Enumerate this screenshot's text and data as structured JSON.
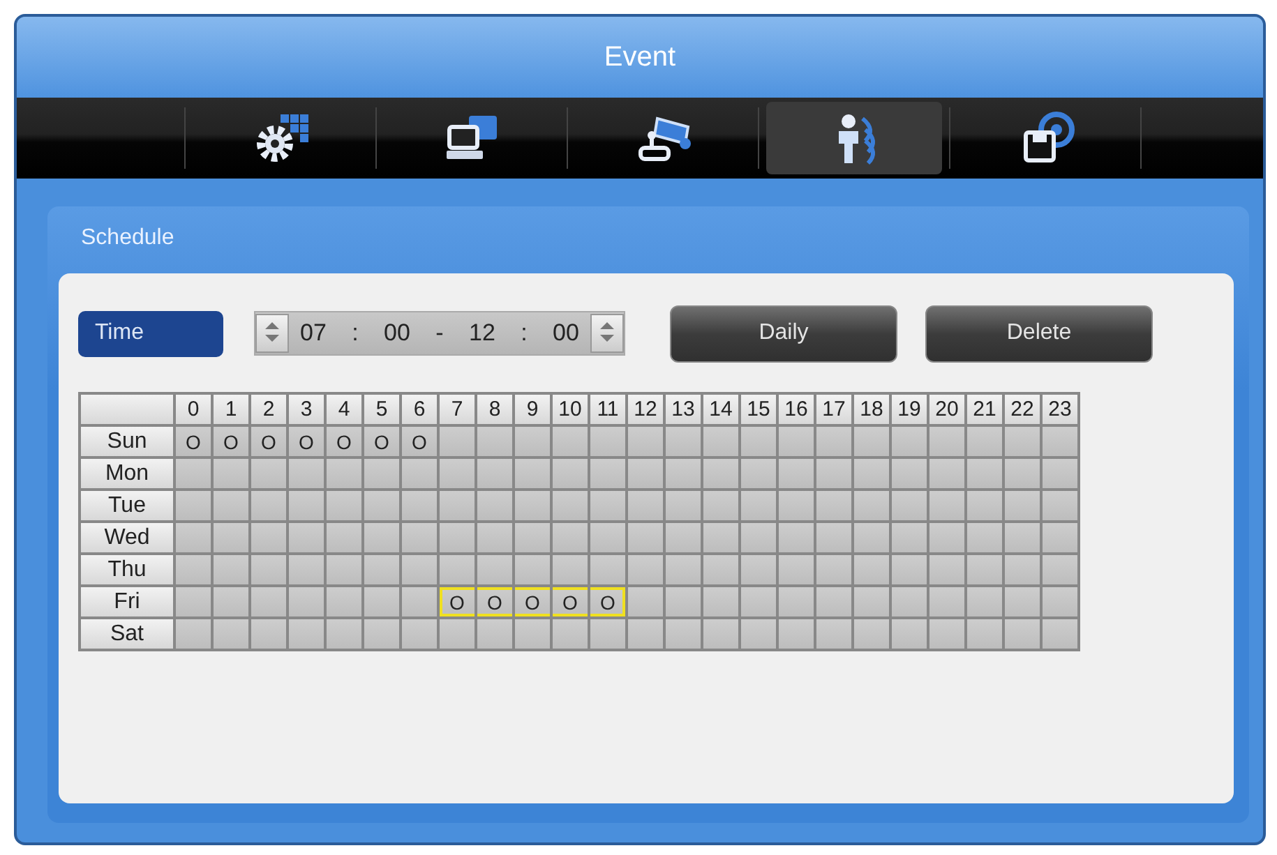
{
  "window": {
    "title": "Event"
  },
  "toolbar": [
    {
      "kind": "setup",
      "selected": false
    },
    {
      "kind": "network",
      "selected": false
    },
    {
      "kind": "camera",
      "selected": false
    },
    {
      "kind": "event",
      "selected": true
    },
    {
      "kind": "storage",
      "selected": false
    }
  ],
  "panel": {
    "title": "Schedule"
  },
  "time": {
    "label": "Time",
    "start": {
      "hour": "07",
      "colon": ":",
      "minute": "00"
    },
    "dash": "-",
    "end": {
      "hour": "12",
      "colon": ":",
      "minute": "00"
    }
  },
  "buttons": [
    "Daily",
    "Delete"
  ],
  "hours": [
    "0",
    "1",
    "2",
    "3",
    "4",
    "5",
    "6",
    "7",
    "8",
    "9",
    "10",
    "11",
    "12",
    "13",
    "14",
    "15",
    "16",
    "17",
    "18",
    "19",
    "20",
    "21",
    "22",
    "23"
  ],
  "rows": [
    {
      "day": "Sun",
      "cells": [
        {
          "mark": "O",
          "selected": false
        },
        {
          "mark": "O",
          "selected": false
        },
        {
          "mark": "O",
          "selected": false
        },
        {
          "mark": "O",
          "selected": false
        },
        {
          "mark": "O",
          "selected": false
        },
        {
          "mark": "O",
          "selected": false
        },
        {
          "mark": "O",
          "selected": false
        },
        {
          "selected": false
        },
        {
          "selected": false
        },
        {
          "selected": false
        },
        {
          "selected": false
        },
        {
          "selected": false
        },
        {
          "selected": false
        },
        {
          "selected": false
        },
        {
          "selected": false
        },
        {
          "selected": false
        },
        {
          "selected": false
        },
        {
          "selected": false
        },
        {
          "selected": false
        },
        {
          "selected": false
        },
        {
          "selected": false
        },
        {
          "selected": false
        },
        {
          "selected": false
        },
        {
          "selected": false
        }
      ]
    },
    {
      "day": "Mon",
      "cells": [
        {
          "selected": false
        },
        {
          "selected": false
        },
        {
          "selected": false
        },
        {
          "selected": false
        },
        {
          "selected": false
        },
        {
          "selected": false
        },
        {
          "selected": false
        },
        {
          "selected": false
        },
        {
          "selected": false
        },
        {
          "selected": false
        },
        {
          "selected": false
        },
        {
          "selected": false
        },
        {
          "selected": false
        },
        {
          "selected": false
        },
        {
          "selected": false
        },
        {
          "selected": false
        },
        {
          "selected": false
        },
        {
          "selected": false
        },
        {
          "selected": false
        },
        {
          "selected": false
        },
        {
          "selected": false
        },
        {
          "selected": false
        },
        {
          "selected": false
        },
        {
          "selected": false
        }
      ]
    },
    {
      "day": "Tue",
      "cells": [
        {
          "selected": false
        },
        {
          "selected": false
        },
        {
          "selected": false
        },
        {
          "selected": false
        },
        {
          "selected": false
        },
        {
          "selected": false
        },
        {
          "selected": false
        },
        {
          "selected": false
        },
        {
          "selected": false
        },
        {
          "selected": false
        },
        {
          "selected": false
        },
        {
          "selected": false
        },
        {
          "selected": false
        },
        {
          "selected": false
        },
        {
          "selected": false
        },
        {
          "selected": false
        },
        {
          "selected": false
        },
        {
          "selected": false
        },
        {
          "selected": false
        },
        {
          "selected": false
        },
        {
          "selected": false
        },
        {
          "selected": false
        },
        {
          "selected": false
        },
        {
          "selected": false
        }
      ]
    },
    {
      "day": "Wed",
      "cells": [
        {
          "selected": false
        },
        {
          "selected": false
        },
        {
          "selected": false
        },
        {
          "selected": false
        },
        {
          "selected": false
        },
        {
          "selected": false
        },
        {
          "selected": false
        },
        {
          "selected": false
        },
        {
          "selected": false
        },
        {
          "selected": false
        },
        {
          "selected": false
        },
        {
          "selected": false
        },
        {
          "selected": false
        },
        {
          "selected": false
        },
        {
          "selected": false
        },
        {
          "selected": false
        },
        {
          "selected": false
        },
        {
          "selected": false
        },
        {
          "selected": false
        },
        {
          "selected": false
        },
        {
          "selected": false
        },
        {
          "selected": false
        },
        {
          "selected": false
        },
        {
          "selected": false
        }
      ]
    },
    {
      "day": "Thu",
      "cells": [
        {
          "selected": false
        },
        {
          "selected": false
        },
        {
          "selected": false
        },
        {
          "selected": false
        },
        {
          "selected": false
        },
        {
          "selected": false
        },
        {
          "selected": false
        },
        {
          "selected": false
        },
        {
          "selected": false
        },
        {
          "selected": false
        },
        {
          "selected": false
        },
        {
          "selected": false
        },
        {
          "selected": false
        },
        {
          "selected": false
        },
        {
          "selected": false
        },
        {
          "selected": false
        },
        {
          "selected": false
        },
        {
          "selected": false
        },
        {
          "selected": false
        },
        {
          "selected": false
        },
        {
          "selected": false
        },
        {
          "selected": false
        },
        {
          "selected": false
        },
        {
          "selected": false
        }
      ]
    },
    {
      "day": "Fri",
      "cells": [
        {
          "selected": false
        },
        {
          "selected": false
        },
        {
          "selected": false
        },
        {
          "selected": false
        },
        {
          "selected": false
        },
        {
          "selected": false
        },
        {
          "selected": false
        },
        {
          "mark": "O",
          "selected": true
        },
        {
          "mark": "O",
          "selected": true
        },
        {
          "mark": "O",
          "selected": true
        },
        {
          "mark": "O",
          "selected": true
        },
        {
          "mark": "O",
          "selected": true
        },
        {
          "selected": false
        },
        {
          "selected": false
        },
        {
          "selected": false
        },
        {
          "selected": false
        },
        {
          "selected": false
        },
        {
          "selected": false
        },
        {
          "selected": false
        },
        {
          "selected": false
        },
        {
          "selected": false
        },
        {
          "selected": false
        },
        {
          "selected": false
        },
        {
          "selected": false
        }
      ]
    },
    {
      "day": "Sat",
      "cells": [
        {
          "selected": false
        },
        {
          "selected": false
        },
        {
          "selected": false
        },
        {
          "selected": false
        },
        {
          "selected": false
        },
        {
          "selected": false
        },
        {
          "selected": false
        },
        {
          "selected": false
        },
        {
          "selected": false
        },
        {
          "selected": false
        },
        {
          "selected": false
        },
        {
          "selected": false
        },
        {
          "selected": false
        },
        {
          "selected": false
        },
        {
          "selected": false
        },
        {
          "selected": false
        },
        {
          "selected": false
        },
        {
          "selected": false
        },
        {
          "selected": false
        },
        {
          "selected": false
        },
        {
          "selected": false
        },
        {
          "selected": false
        },
        {
          "selected": false
        },
        {
          "selected": false
        }
      ]
    }
  ]
}
